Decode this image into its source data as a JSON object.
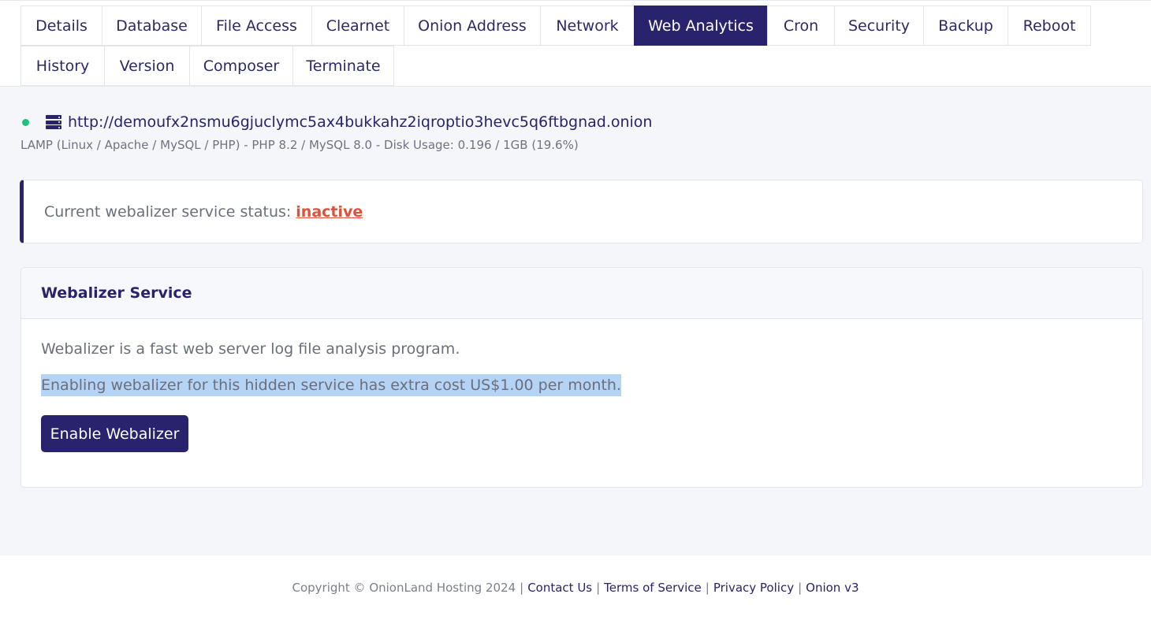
{
  "tabs": [
    {
      "label": "Details"
    },
    {
      "label": "Database"
    },
    {
      "label": "File Access"
    },
    {
      "label": "Clearnet"
    },
    {
      "label": "Onion Address"
    },
    {
      "label": "Network"
    },
    {
      "label": "Web Analytics",
      "active": true
    },
    {
      "label": "Cron"
    },
    {
      "label": "Security"
    },
    {
      "label": "Backup"
    },
    {
      "label": "Reboot"
    },
    {
      "label": "History"
    },
    {
      "label": "Version"
    },
    {
      "label": "Composer"
    },
    {
      "label": "Terminate"
    }
  ],
  "server": {
    "url": "http://demoufx2nsmu6gjuclymc5ax4bukkahz2iqroptio3hevc5q6ftbgnad.onion",
    "meta": "LAMP (Linux / Apache / MySQL / PHP) - PHP 8.2 / MySQL 8.0 - Disk Usage: 0.196 / 1GB (19.6%)",
    "status_icon": "server-icon",
    "online_color": "#1fc27a"
  },
  "alert": {
    "prefix": "Current webalizer service status:",
    "status": "inactive",
    "status_color": "#e14e3a"
  },
  "card": {
    "title": "Webalizer Service",
    "description": "Webalizer is a fast web server log file analysis program.",
    "cost_note": "Enabling webalizer for this hidden service has extra cost US$1.00 per month.",
    "button_label": "Enable Webalizer"
  },
  "footer": {
    "copyright": "Copyright © OnionLand Hosting 2024",
    "links": [
      "Contact Us",
      "Terms of Service",
      "Privacy Policy",
      "Onion v3"
    ],
    "separator": "|"
  },
  "theme": {
    "primary": "#28236c",
    "background": "#f5f6fa"
  }
}
